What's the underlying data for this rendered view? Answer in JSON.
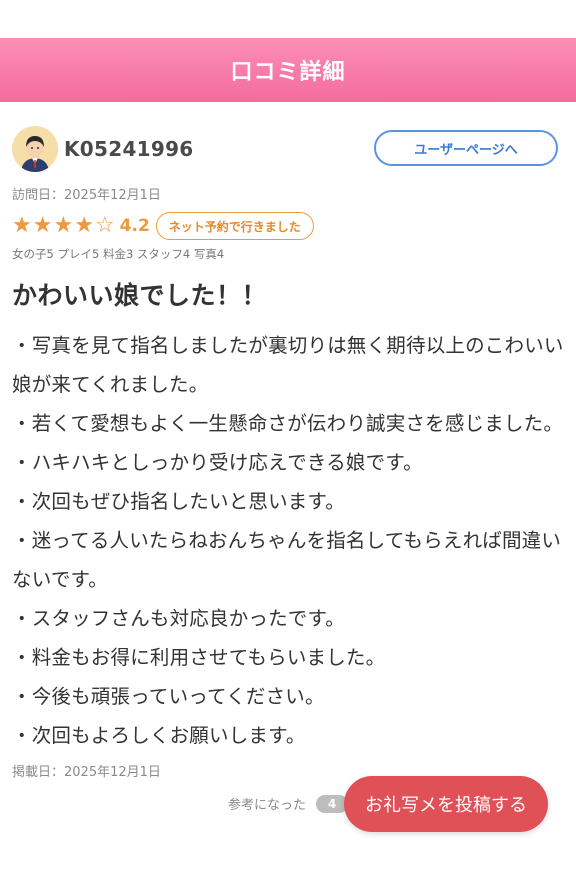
{
  "header": {
    "title": "口コミ詳細"
  },
  "user": {
    "name": "K05241996",
    "user_page_label": "ユーザーページへ"
  },
  "visit_date": "訪問日：2025年12月1日",
  "rating": {
    "stars_filled": 4,
    "stars_total": 5,
    "score": "4.2",
    "badge": "ネット予約で行きました",
    "sub_ratings": "女の子5 プレイ5 料金3 スタッフ4 写真4",
    "colors": {
      "accent": "#ec9a3f"
    }
  },
  "review": {
    "title": "かわいい娘でした！！",
    "lines": [
      "・写真を見て指名しましたが裏切りは無く期待以上のこわいい娘が来てくれました。",
      "・若くて愛想もよく一生懸命さが伝わり誠実さを感じました。",
      "・ハキハキとしっかり受け応えできる娘です。",
      "・次回もぜひ指名したいと思います。",
      "・迷ってる人いたらねおんちゃんを指名してもらえれば間違いないです。",
      "・スタッフさんも対応良かったです。",
      "・料金もお得に利用させてもらいました。",
      "・今後も頑張っていってください。",
      "・次回もよろしくお願いします。"
    ]
  },
  "posted_date": "掲載日：2025年12月1日",
  "helpful": {
    "label": "参考になった",
    "count": "4"
  },
  "fab": {
    "label": "お礼写メを投稿する"
  },
  "theme": {
    "header_pink": "#f56b9c",
    "fab_red": "#e05157",
    "link_blue": "#3a7bd5"
  }
}
